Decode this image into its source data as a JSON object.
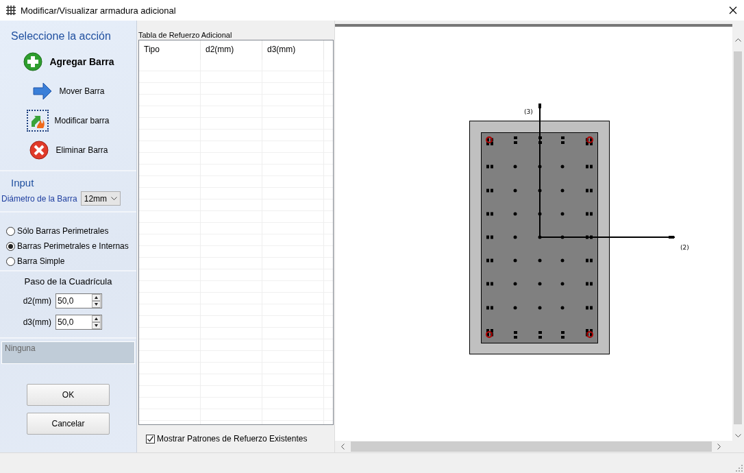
{
  "window": {
    "title": "Modificar/Visualizar armadura adicional"
  },
  "actions": {
    "heading": "Seleccione la acción",
    "items": [
      {
        "label": "Agregar Barra",
        "kind": "add",
        "selected": true,
        "focused": false
      },
      {
        "label": "Mover Barra",
        "kind": "move",
        "selected": false,
        "focused": false
      },
      {
        "label": "Modificar barra",
        "kind": "modify",
        "selected": false,
        "focused": true
      },
      {
        "label": "Eliminar Barra",
        "kind": "delete",
        "selected": false,
        "focused": false
      }
    ]
  },
  "input": {
    "heading": "Input",
    "diameter_label": "Diámetro de la Barra",
    "diameter_value": "12mm"
  },
  "bar_pattern": [
    {
      "label": "Sólo Barras Perimetrales",
      "selected": false
    },
    {
      "label": "Barras Perimetrales e Internas",
      "selected": true
    },
    {
      "label": "Barra Simple",
      "selected": false
    }
  ],
  "grid_step": {
    "heading": "Paso de la Cuadrícula",
    "fields": [
      {
        "label": "d2(mm)",
        "value": "50,0"
      },
      {
        "label": "d3(mm)",
        "value": "50,0"
      }
    ]
  },
  "status_box": "Ninguna",
  "buttons": [
    "OK",
    "Cancelar"
  ],
  "table": {
    "caption": "Tabla de Refuerzo Adicional",
    "columns": [
      "Tipo",
      "d2(mm)",
      "d3(mm)"
    ]
  },
  "show_existing": {
    "label": "Mostrar Patrones de Refuerzo Existentes",
    "checked": true
  },
  "section": {
    "axis_labels": [
      "(3)",
      "(2)"
    ]
  }
}
